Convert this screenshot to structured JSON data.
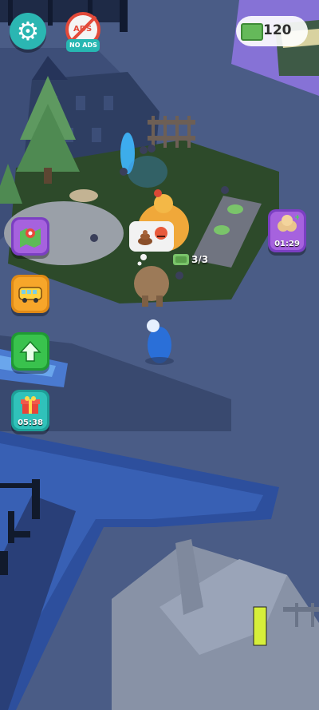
{
  "hud": {
    "currency_value": "120",
    "no_ads_top": "ADS",
    "no_ads_label": "NO ADS",
    "bonus_timer": "01:29",
    "gift_timer": "05:38"
  },
  "scene": {
    "counter": "3/3"
  },
  "icons": {
    "settings": "gear-icon",
    "no_ads": "no-ads-icon",
    "cash": "cash-icon",
    "map": "map-icon",
    "bus": "bus-icon",
    "upgrade": "up-arrow-icon",
    "gift": "gift-icon",
    "bonus": "coin-stack-icon"
  },
  "colors": {
    "teal": "#3ad0c8",
    "purple": "#9b52d6",
    "orange": "#f5a623",
    "green": "#35c04a",
    "grass": "#2d4a2a",
    "floor": "#4a5c86"
  }
}
